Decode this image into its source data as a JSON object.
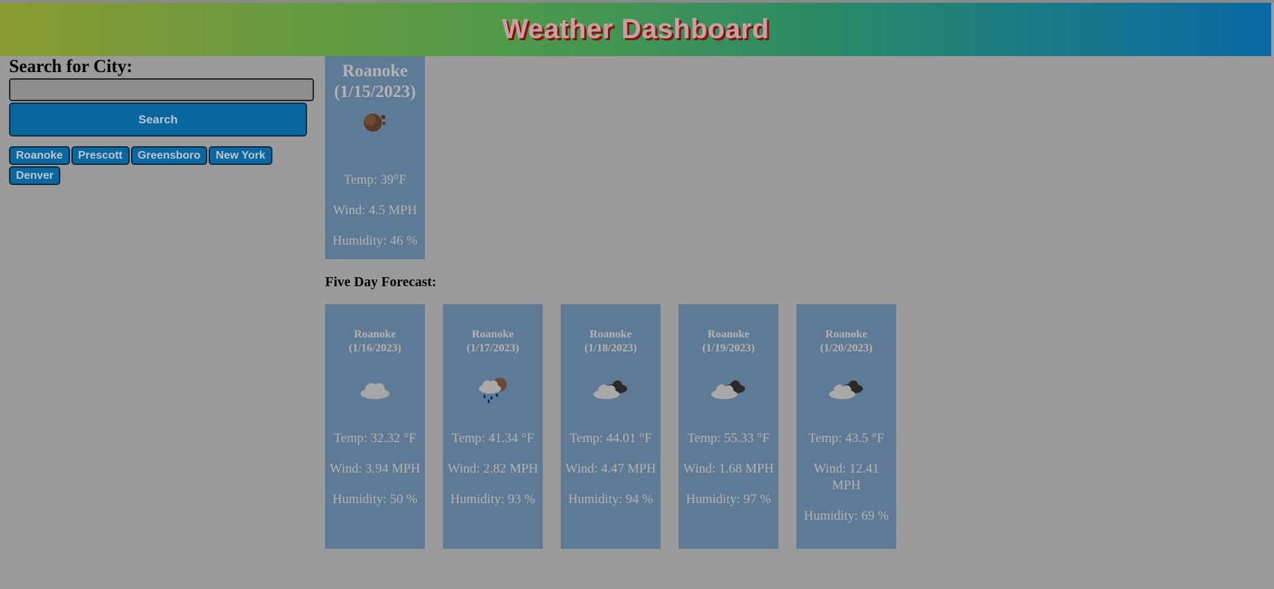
{
  "header": {
    "title": "Weather Dashboard"
  },
  "search": {
    "label": "Search for City:",
    "input_value": "",
    "button_label": "Search",
    "history": [
      "Roanoke",
      "Prescott",
      "Greensboro",
      "New York",
      "Denver"
    ]
  },
  "current": {
    "title": "Roanoke (1/15/2023)",
    "icon": "moon-icon",
    "temp": "Temp: 39°F",
    "wind": "Wind: 4.5 MPH",
    "humidity": "Humidity: 46 %"
  },
  "forecast": {
    "heading": "Five Day Forecast:",
    "days": [
      {
        "title": "Roanoke (1/16/2023)",
        "icon": "cloud-icon",
        "temp": "Temp: 32.32 °F",
        "wind": "Wind: 3.94 MPH",
        "humidity": "Humidity: 50 %"
      },
      {
        "title": "Roanoke (1/17/2023)",
        "icon": "rain-cloud-icon",
        "temp": "Temp: 41.34 °F",
        "wind": "Wind: 2.82 MPH",
        "humidity": "Humidity: 93 %"
      },
      {
        "title": "Roanoke (1/18/2023)",
        "icon": "broken-clouds-icon",
        "temp": "Temp: 44.01 °F",
        "wind": "Wind: 4.47 MPH",
        "humidity": "Humidity: 94 %"
      },
      {
        "title": "Roanoke (1/19/2023)",
        "icon": "broken-clouds-icon",
        "temp": "Temp: 55.33 °F",
        "wind": "Wind: 1.68 MPH",
        "humidity": "Humidity: 97 %"
      },
      {
        "title": "Roanoke (1/20/2023)",
        "icon": "broken-clouds-icon",
        "temp": "Temp: 43.5 °F",
        "wind": "Wind: 12.41 MPH",
        "humidity": "Humidity: 69 %"
      }
    ]
  },
  "colors": {
    "header_start": "#8a9a32",
    "header_end": "#0a68a6",
    "button_blue": "#08659e",
    "card_bg": "#5e7a95",
    "page_bg": "#9b9b9b"
  }
}
